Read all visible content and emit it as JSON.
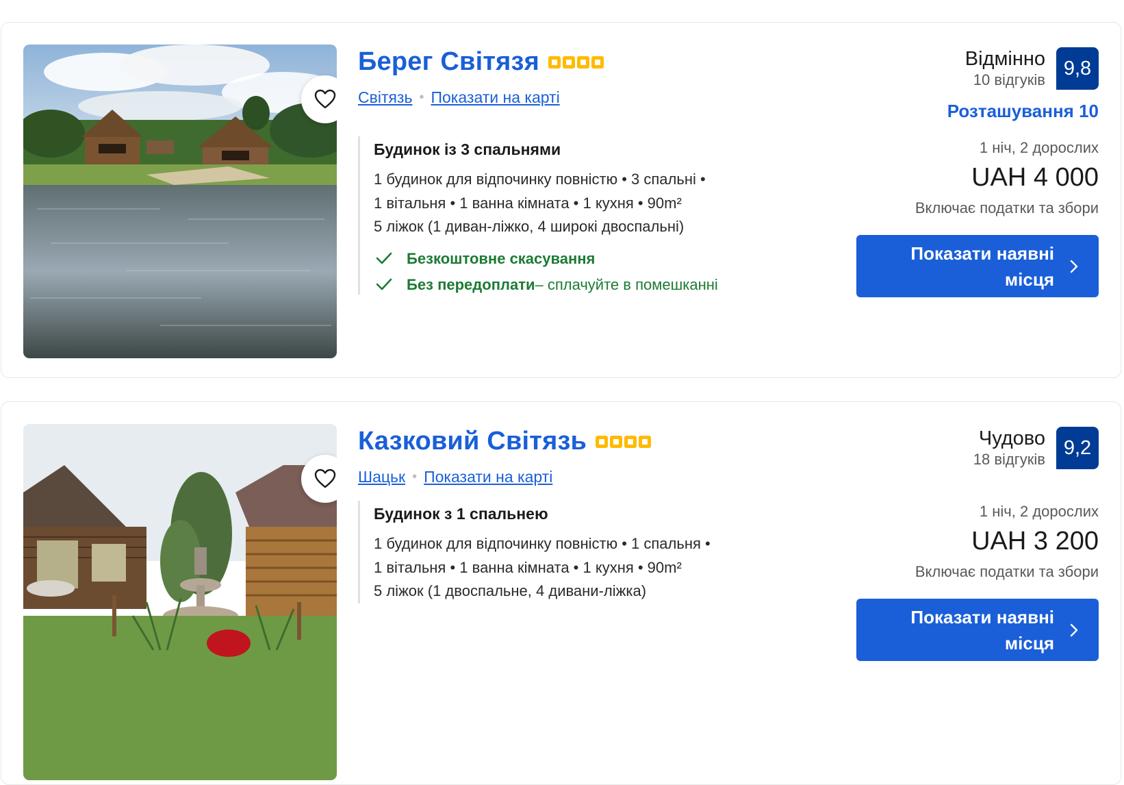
{
  "listings": [
    {
      "name": "Берег Світязя",
      "stars": 4,
      "city": "Світязь",
      "map_link": "Показати на карті",
      "room_type": "Будинок із 3 спальнями",
      "details": [
        "1 будинок для відпочинку повністю • 3 спальні •",
        "1 вітальня • 1 ванна кімната • 1 кухня • 90m²",
        "5 ліжок (1 диван-ліжко, 4 широкі двоспальні)"
      ],
      "perks": [
        {
          "bold": "Безкоштовне скасування",
          "rest": ""
        },
        {
          "bold": "Без передоплати",
          "rest": " – сплачуйте в помешканні"
        }
      ],
      "rating_word": "Відмінно",
      "reviews": "10 відгуків",
      "score": "9,8",
      "location_score": "Розташування 10",
      "occupancy": "1 ніч, 2 дорослих",
      "price": "UAH 4 000",
      "taxes": "Включає податки та збори",
      "cta": "Показати наявні місця"
    },
    {
      "name": "Казковий Світязь",
      "stars": 4,
      "city": "Шацьк",
      "map_link": "Показати на карті",
      "room_type": "Будинок з 1 спальнею",
      "details": [
        "1 будинок для відпочинку повністю • 1 спальня •",
        "1 вітальня • 1 ванна кімната • 1 кухня • 90m²",
        "5 ліжок (1 двоспальне, 4 дивани-ліжка)"
      ],
      "perks": [],
      "rating_word": "Чудово",
      "reviews": "18 відгуків",
      "score": "9,2",
      "location_score": "",
      "occupancy": "1 ніч, 2 дорослих",
      "price": "UAH 3 200",
      "taxes": "Включає податки та збори",
      "cta": "Показати наявні місця"
    }
  ],
  "colors": {
    "link_blue": "#1a5fd8",
    "score_navy": "#003b95",
    "star_yellow": "#febb02",
    "perk_green": "#1d7a34"
  },
  "icons": {
    "favorite": "heart-outline-icon",
    "perk": "checkmark-icon",
    "cta": "chevron-right-icon"
  }
}
